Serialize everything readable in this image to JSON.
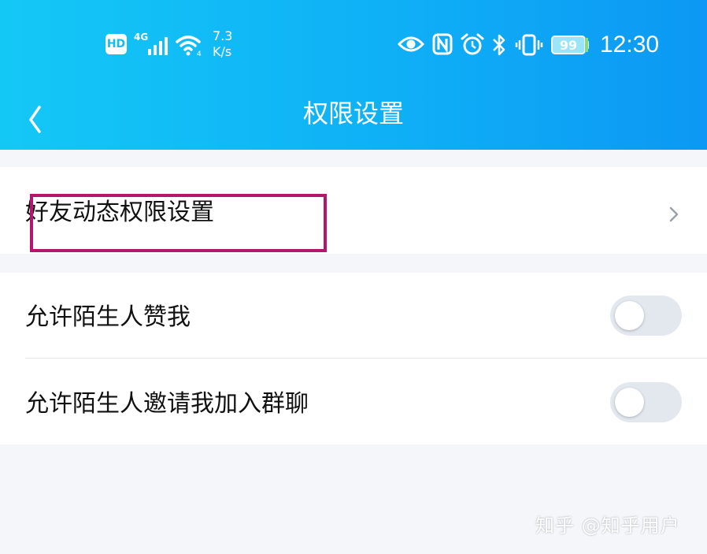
{
  "status_bar": {
    "hd": "HD",
    "network_type": "4G",
    "speed_value": "7.3",
    "speed_unit": "K/s",
    "battery_level": "99",
    "time": "12:30",
    "icons": [
      "hd-icon",
      "signal-icon",
      "wifi-icon",
      "eye-icon",
      "nfc-icon",
      "alarm-icon",
      "bluetooth-icon",
      "vibrate-icon",
      "battery-icon"
    ]
  },
  "nav": {
    "back_icon": "chevron-left-icon",
    "title": "权限设置"
  },
  "settings": {
    "friend_moments": {
      "label": "好友动态权限设置",
      "icon": "chevron-right-icon"
    },
    "toggles": [
      {
        "label": "允许陌生人赞我",
        "on": false
      },
      {
        "label": "允许陌生人邀请我加入群聊",
        "on": false
      }
    ]
  },
  "colors": {
    "header_start": "#14c8f6",
    "header_end": "#0c98f4",
    "highlight_box": "#b3166c",
    "toggle_off": "#e3e8ef",
    "page_bg": "#f5f6fa"
  },
  "watermark": "知乎 @知乎用户"
}
